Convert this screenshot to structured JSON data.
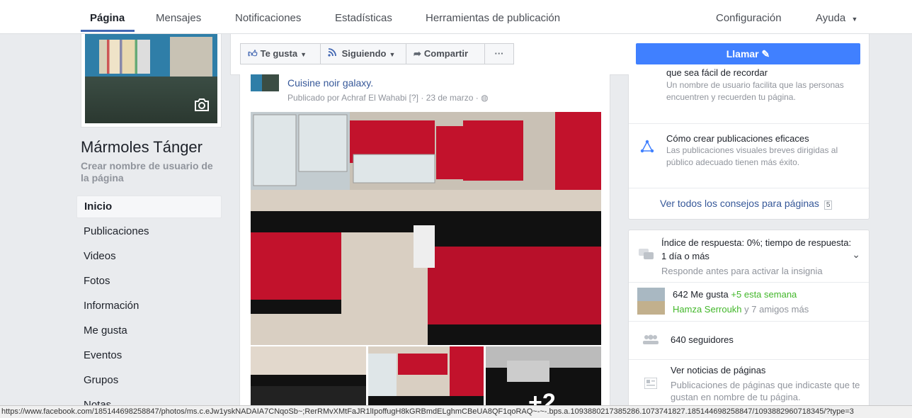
{
  "topnav": {
    "tabs": [
      "Página",
      "Mensajes",
      "Notificaciones",
      "Estadísticas",
      "Herramientas de publicación"
    ],
    "settings": "Configuración",
    "help": "Ayuda"
  },
  "left": {
    "page_name": "Mármoles Tánger",
    "username_link": "Crear nombre de usuario de la página",
    "nav": [
      "Inicio",
      "Publicaciones",
      "Videos",
      "Fotos",
      "Información",
      "Me gusta",
      "Eventos",
      "Grupos",
      "Notas"
    ]
  },
  "actions": {
    "like": "Te gusta",
    "following": "Siguiendo",
    "share": "Compartir",
    "more": "···",
    "call": "Llamar"
  },
  "post": {
    "title": "Cuisine noir galaxy.",
    "author_prefix": "Publicado por",
    "author": "Achraf El Wahabi",
    "qmark": "[?]",
    "date": "23 de marzo",
    "more_photos": "+2"
  },
  "tips": {
    "tip1_title_partial": "que sea fácil de recordar",
    "tip1_desc": "Un nombre de usuario facilita que las personas encuentren y recuerden tu página.",
    "tip2_title": "Cómo crear publicaciones eficaces",
    "tip2_desc": "Las publicaciones visuales breves dirigidas al público adecuado tienen más éxito.",
    "see_all": "Ver todos los consejos para páginas",
    "see_all_count": "5"
  },
  "stats": {
    "response_line1": "Índice de respuesta: 0%; tiempo de respuesta:",
    "response_line2": "1 día o más",
    "response_hint": "Responde antes para activar la insignia",
    "likes": "642 Me gusta",
    "likes_week": "+5 esta semana",
    "friend_name": "Hamza Serroukh",
    "friends_more": "y 7 amigos más",
    "followers": "640 seguidores",
    "news_title": "Ver noticias de páginas",
    "news_desc": "Publicaciones de páginas que indicaste que te gustan en nombre de tu página."
  },
  "statusbar": {
    "url": "https://www.facebook.com/185144698258847/photos/ms.c.eJw1yskNADAIA7CNqoSb~;RerRMvXMtFaJR1lIpoffugH8kGRBmdELghmCBeUA8QF1qoRAQ~-~-.bps.a.1093880217385286.1073741827.185144698258847/1093882960718345/?type=3"
  },
  "colors": {
    "brand_blue": "#4267b2",
    "call_button": "#4080ff",
    "link_blue": "#365899",
    "green": "#42b72a",
    "background": "#e9ebee"
  }
}
